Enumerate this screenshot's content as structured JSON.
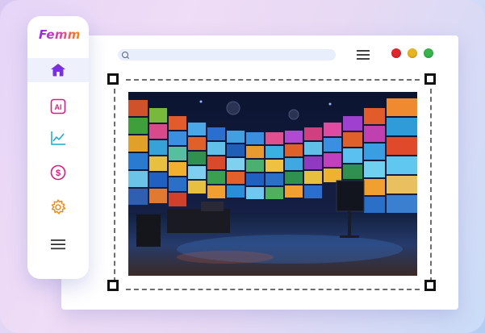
{
  "app": {
    "brand": "Femme"
  },
  "sidebar": {
    "items": [
      {
        "icon": "home-icon",
        "active": true
      },
      {
        "icon": "ai-icon",
        "label": "AI"
      },
      {
        "icon": "chart-line-icon"
      },
      {
        "icon": "dollar-icon",
        "label": "$"
      },
      {
        "icon": "gear-icon"
      },
      {
        "icon": "menu-icon"
      }
    ]
  },
  "window": {
    "controls": [
      {
        "name": "close",
        "color": "#e0262b"
      },
      {
        "name": "minimize",
        "color": "#e8b41f"
      },
      {
        "name": "maximize",
        "color": "#37b34a"
      }
    ]
  },
  "colors": {
    "accent": "#8a2be2",
    "icon_active": "#7b2fe0",
    "icon_pink": "#d61f7e",
    "icon_teal": "#1aa7c7",
    "icon_orange": "#f08a1c"
  }
}
